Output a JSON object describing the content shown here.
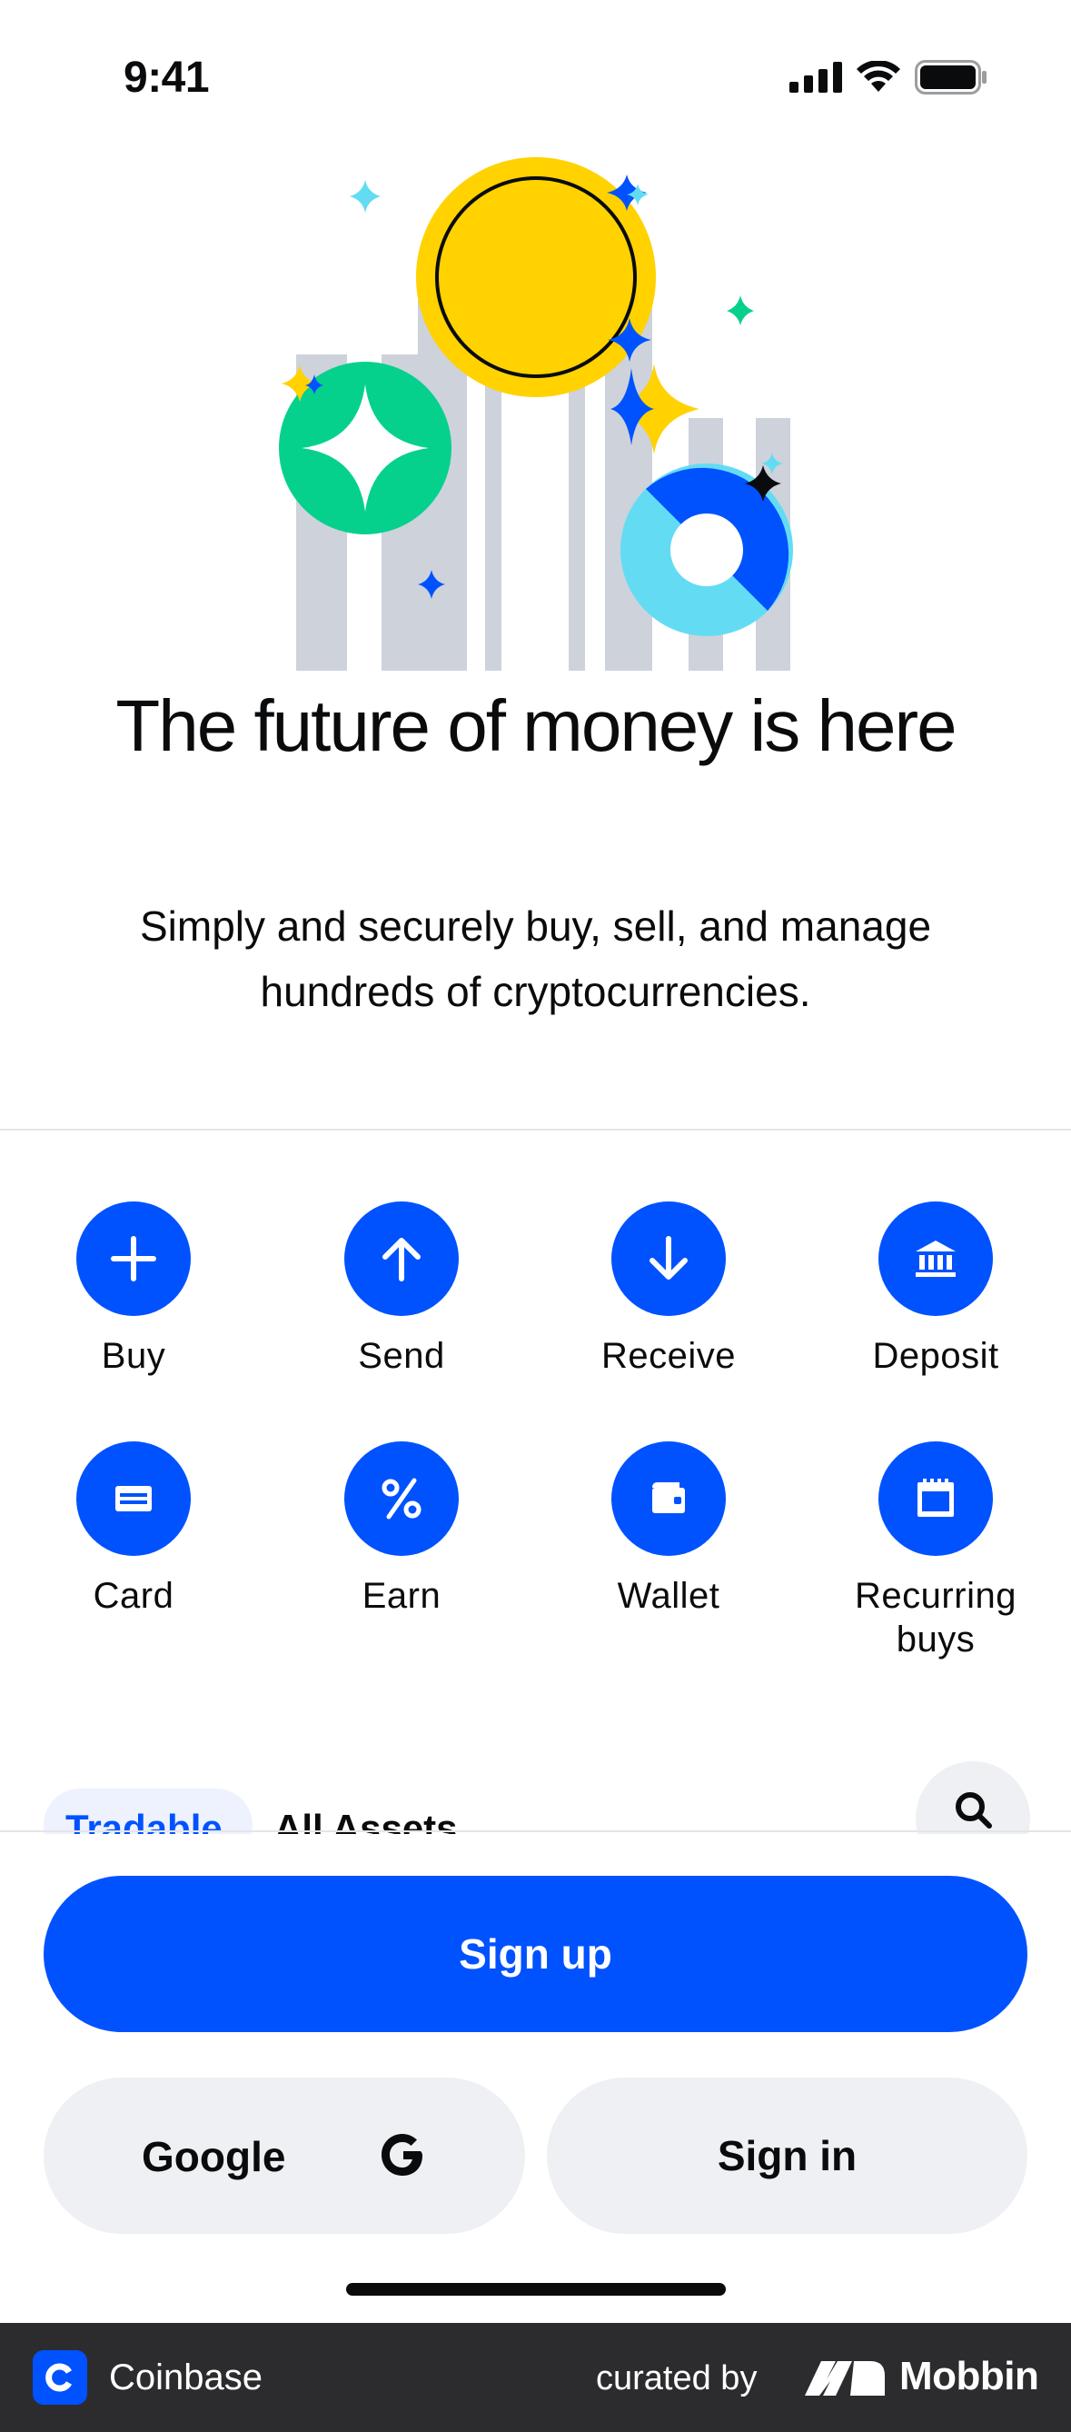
{
  "status_bar": {
    "time": "9:41"
  },
  "hero": {
    "headline": "The future of money is here",
    "subhead": "Simply and securely buy, sell, and manage hundreds of cryptocurrencies."
  },
  "actions": [
    {
      "label": "Buy",
      "icon": "plus-icon"
    },
    {
      "label": "Send",
      "icon": "arrow-up-icon"
    },
    {
      "label": "Receive",
      "icon": "arrow-down-icon"
    },
    {
      "label": "Deposit",
      "icon": "bank-icon"
    },
    {
      "label": "Card",
      "icon": "card-icon"
    },
    {
      "label": "Earn",
      "icon": "percent-icon"
    },
    {
      "label": "Wallet",
      "icon": "wallet-icon"
    },
    {
      "label": "Recurring buys",
      "icon": "calendar-icon"
    }
  ],
  "filters": {
    "tradable": "Tradable",
    "all_assets": "All Assets"
  },
  "auth": {
    "signup": "Sign up",
    "google": "Google",
    "signin": "Sign in"
  },
  "footer": {
    "app_name": "Coinbase",
    "curated_by": "curated by",
    "brand": "Mobbin"
  },
  "colors": {
    "primary": "#0052ff",
    "secondary_bg": "#eef0f3",
    "text": "#0a0b0d"
  }
}
